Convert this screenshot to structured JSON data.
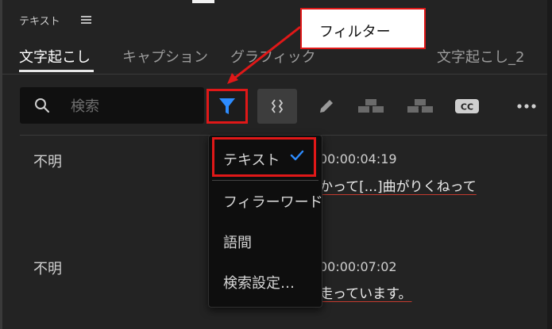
{
  "panel": {
    "title": "テキスト"
  },
  "tabs": [
    {
      "label": "文字起こし"
    },
    {
      "label": "キャプション"
    },
    {
      "label": "グラフィック"
    },
    {
      "label": "文字起こし_2"
    }
  ],
  "search": {
    "placeholder": "検索"
  },
  "toolbar": {
    "icons": [
      "filter-icon",
      "split-icon",
      "pencil-icon",
      "merge-icon",
      "split-clip-icon",
      "cc-icon",
      "more-icon"
    ],
    "cc_label": "CC"
  },
  "transcript": [
    {
      "speaker": "不明",
      "timestamp": "00:00:04:19",
      "text": "かって[...]曲がりくねって"
    },
    {
      "speaker": "不明",
      "timestamp": "00:00:07:02",
      "text": "走っています。"
    }
  ],
  "filter_menu": {
    "items": [
      "テキスト",
      "フィラーワード",
      "語間",
      "検索設定…"
    ],
    "selected": "テキスト"
  },
  "annotation": {
    "callout": "フィルター"
  },
  "colors": {
    "accent_blue": "#2d8cff",
    "highlight_red": "#e01818",
    "underline_red": "#c43b2f"
  }
}
